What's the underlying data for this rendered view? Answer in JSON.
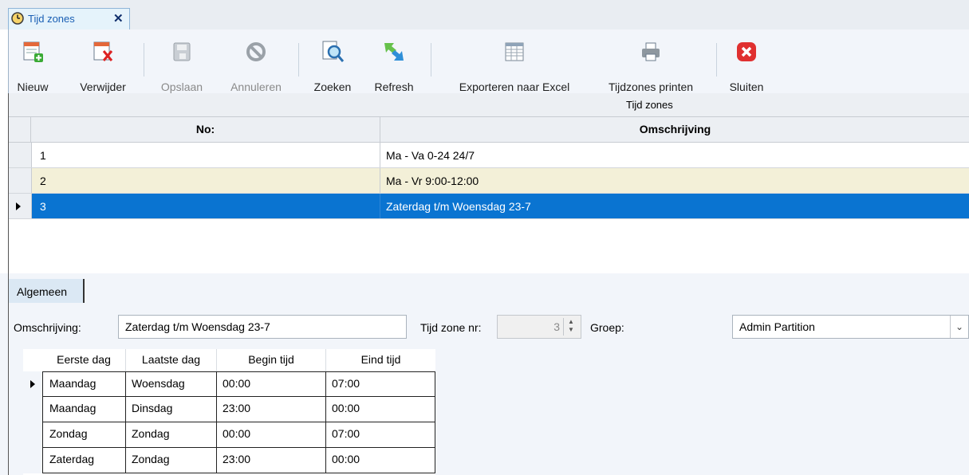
{
  "tab": {
    "title": "Tijd zones",
    "close": "✕"
  },
  "toolbar": {
    "new": "Nieuw",
    "delete": "Verwijder",
    "save": "Opslaan",
    "cancel": "Annuleren",
    "search": "Zoeken",
    "refresh": "Refresh",
    "export": "Exporteren naar Excel",
    "print": "Tijdzones printen",
    "close": "Sluiten"
  },
  "grid": {
    "band_title": "Tijd zones",
    "columns": [
      "No:",
      "Omschrijving"
    ],
    "rows": [
      {
        "no": "1",
        "omschrijving": "Ma - Va 0-24 24/7"
      },
      {
        "no": "2",
        "omschrijving": "Ma - Vr  9:00-12:00"
      },
      {
        "no": "3",
        "omschrijving": "Zaterdag t/m Woensdag 23-7"
      }
    ]
  },
  "detail": {
    "tab": "Algemeen",
    "omschrijving_label": "Omschrijving:",
    "omschrijving_value": "Zaterdag t/m Woensdag 23-7",
    "nr_label": "Tijd zone nr:",
    "nr_value": "3",
    "groep_label": "Groep:",
    "groep_value": "Admin Partition"
  },
  "schedule": {
    "columns": [
      "Eerste dag",
      "Laatste dag",
      "Begin tijd",
      "Eind tijd"
    ],
    "rows": [
      [
        "Maandag",
        "Woensdag",
        "00:00",
        "07:00"
      ],
      [
        "Maandag",
        "Dinsdag",
        "23:00",
        "00:00"
      ],
      [
        "Zondag",
        "Zondag",
        "00:00",
        "07:00"
      ],
      [
        "Zaterdag",
        "Zondag",
        "23:00",
        "00:00"
      ]
    ]
  },
  "colors": {
    "selection": "#0a74d1",
    "alt_row": "#f3f0d8",
    "tab_text": "#1a5fb4"
  }
}
